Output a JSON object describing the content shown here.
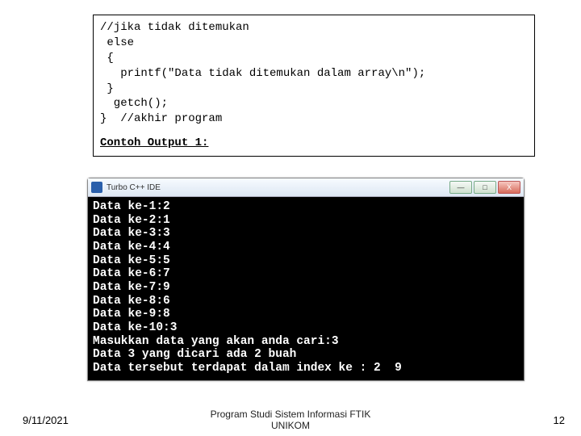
{
  "code": {
    "l1": "//jika tidak ditemukan",
    "l2": " else",
    "l3": " {",
    "l4": "   printf(\"Data tidak ditemukan dalam array\\n\");",
    "l5": " }",
    "l6": "  getch();",
    "l7": "}  //akhir program"
  },
  "output_label": "Contoh Output 1:",
  "window": {
    "title": "Turbo C++ IDE",
    "min": "—",
    "max": "□",
    "close": "X"
  },
  "console": {
    "l1": "Data ke-1:2",
    "l2": "Data ke-2:1",
    "l3": "Data ke-3:3",
    "l4": "Data ke-4:4",
    "l5": "Data ke-5:5",
    "l6": "Data ke-6:7",
    "l7": "Data ke-7:9",
    "l8": "Data ke-8:6",
    "l9": "Data ke-9:8",
    "l10": "Data ke-10:3",
    "l11": "Masukkan data yang akan anda cari:3",
    "l12": "Data 3 yang dicari ada 2 buah",
    "l13": "Data tersebut terdapat dalam index ke : 2  9"
  },
  "footer": {
    "date": "9/11/2021",
    "center_line1": "Program Studi Sistem Informasi FTIK",
    "center_line2": "UNIKOM",
    "page": "12"
  }
}
